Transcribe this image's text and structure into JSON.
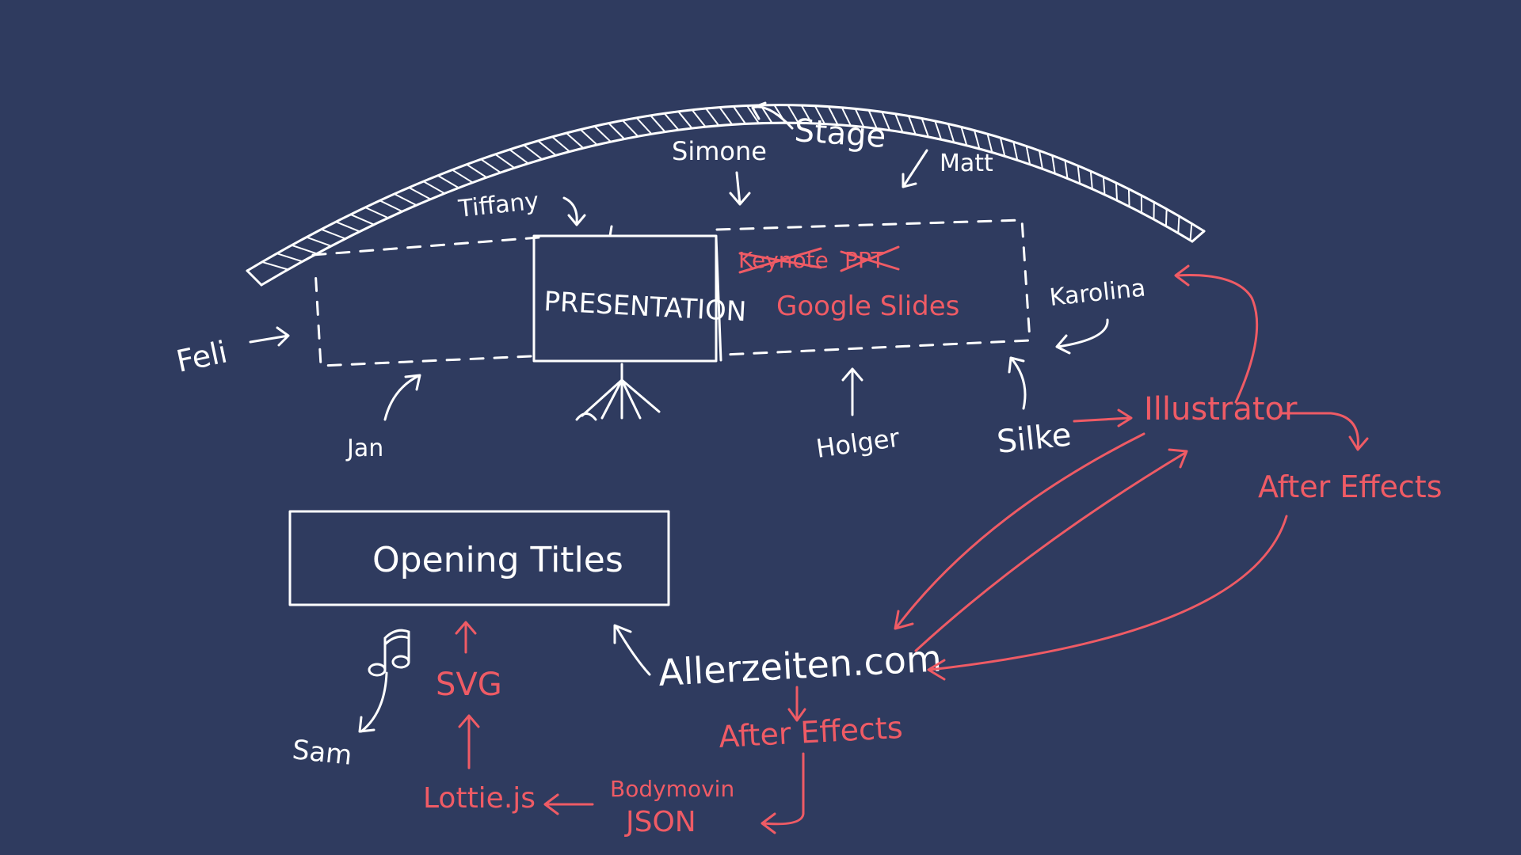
{
  "colors": {
    "background": "#2f3b5f",
    "ink": "#ffffff",
    "accent": "#ef5b65"
  },
  "stage": {
    "label": "Stage"
  },
  "screen": {
    "label": "PRESENTATION"
  },
  "people": {
    "simone": "Simone",
    "matt": "Matt",
    "tiffany": "Tiffany",
    "feli": "Feli",
    "jan": "Jan",
    "holger": "Holger",
    "silke": "Silke",
    "karolina": "Karolina",
    "sam": "Sam"
  },
  "slides_tools": {
    "struck": [
      "Keynote",
      "PPT"
    ],
    "chosen": "Google Slides"
  },
  "pipeline": {
    "illustrator": "Illustrator",
    "after_effects_top": "After Effects",
    "site": "Allerzeiten.com",
    "after_effects_bottom": "After Effects",
    "bodymovin_line1": "Bodymovin",
    "bodymovin_line2": "JSON",
    "lottie": "Lottie.js",
    "svg": "SVG"
  },
  "opening_titles": {
    "label": "Opening Titles"
  },
  "icons": [
    "music-note-icon",
    "projector-tripod-icon"
  ]
}
